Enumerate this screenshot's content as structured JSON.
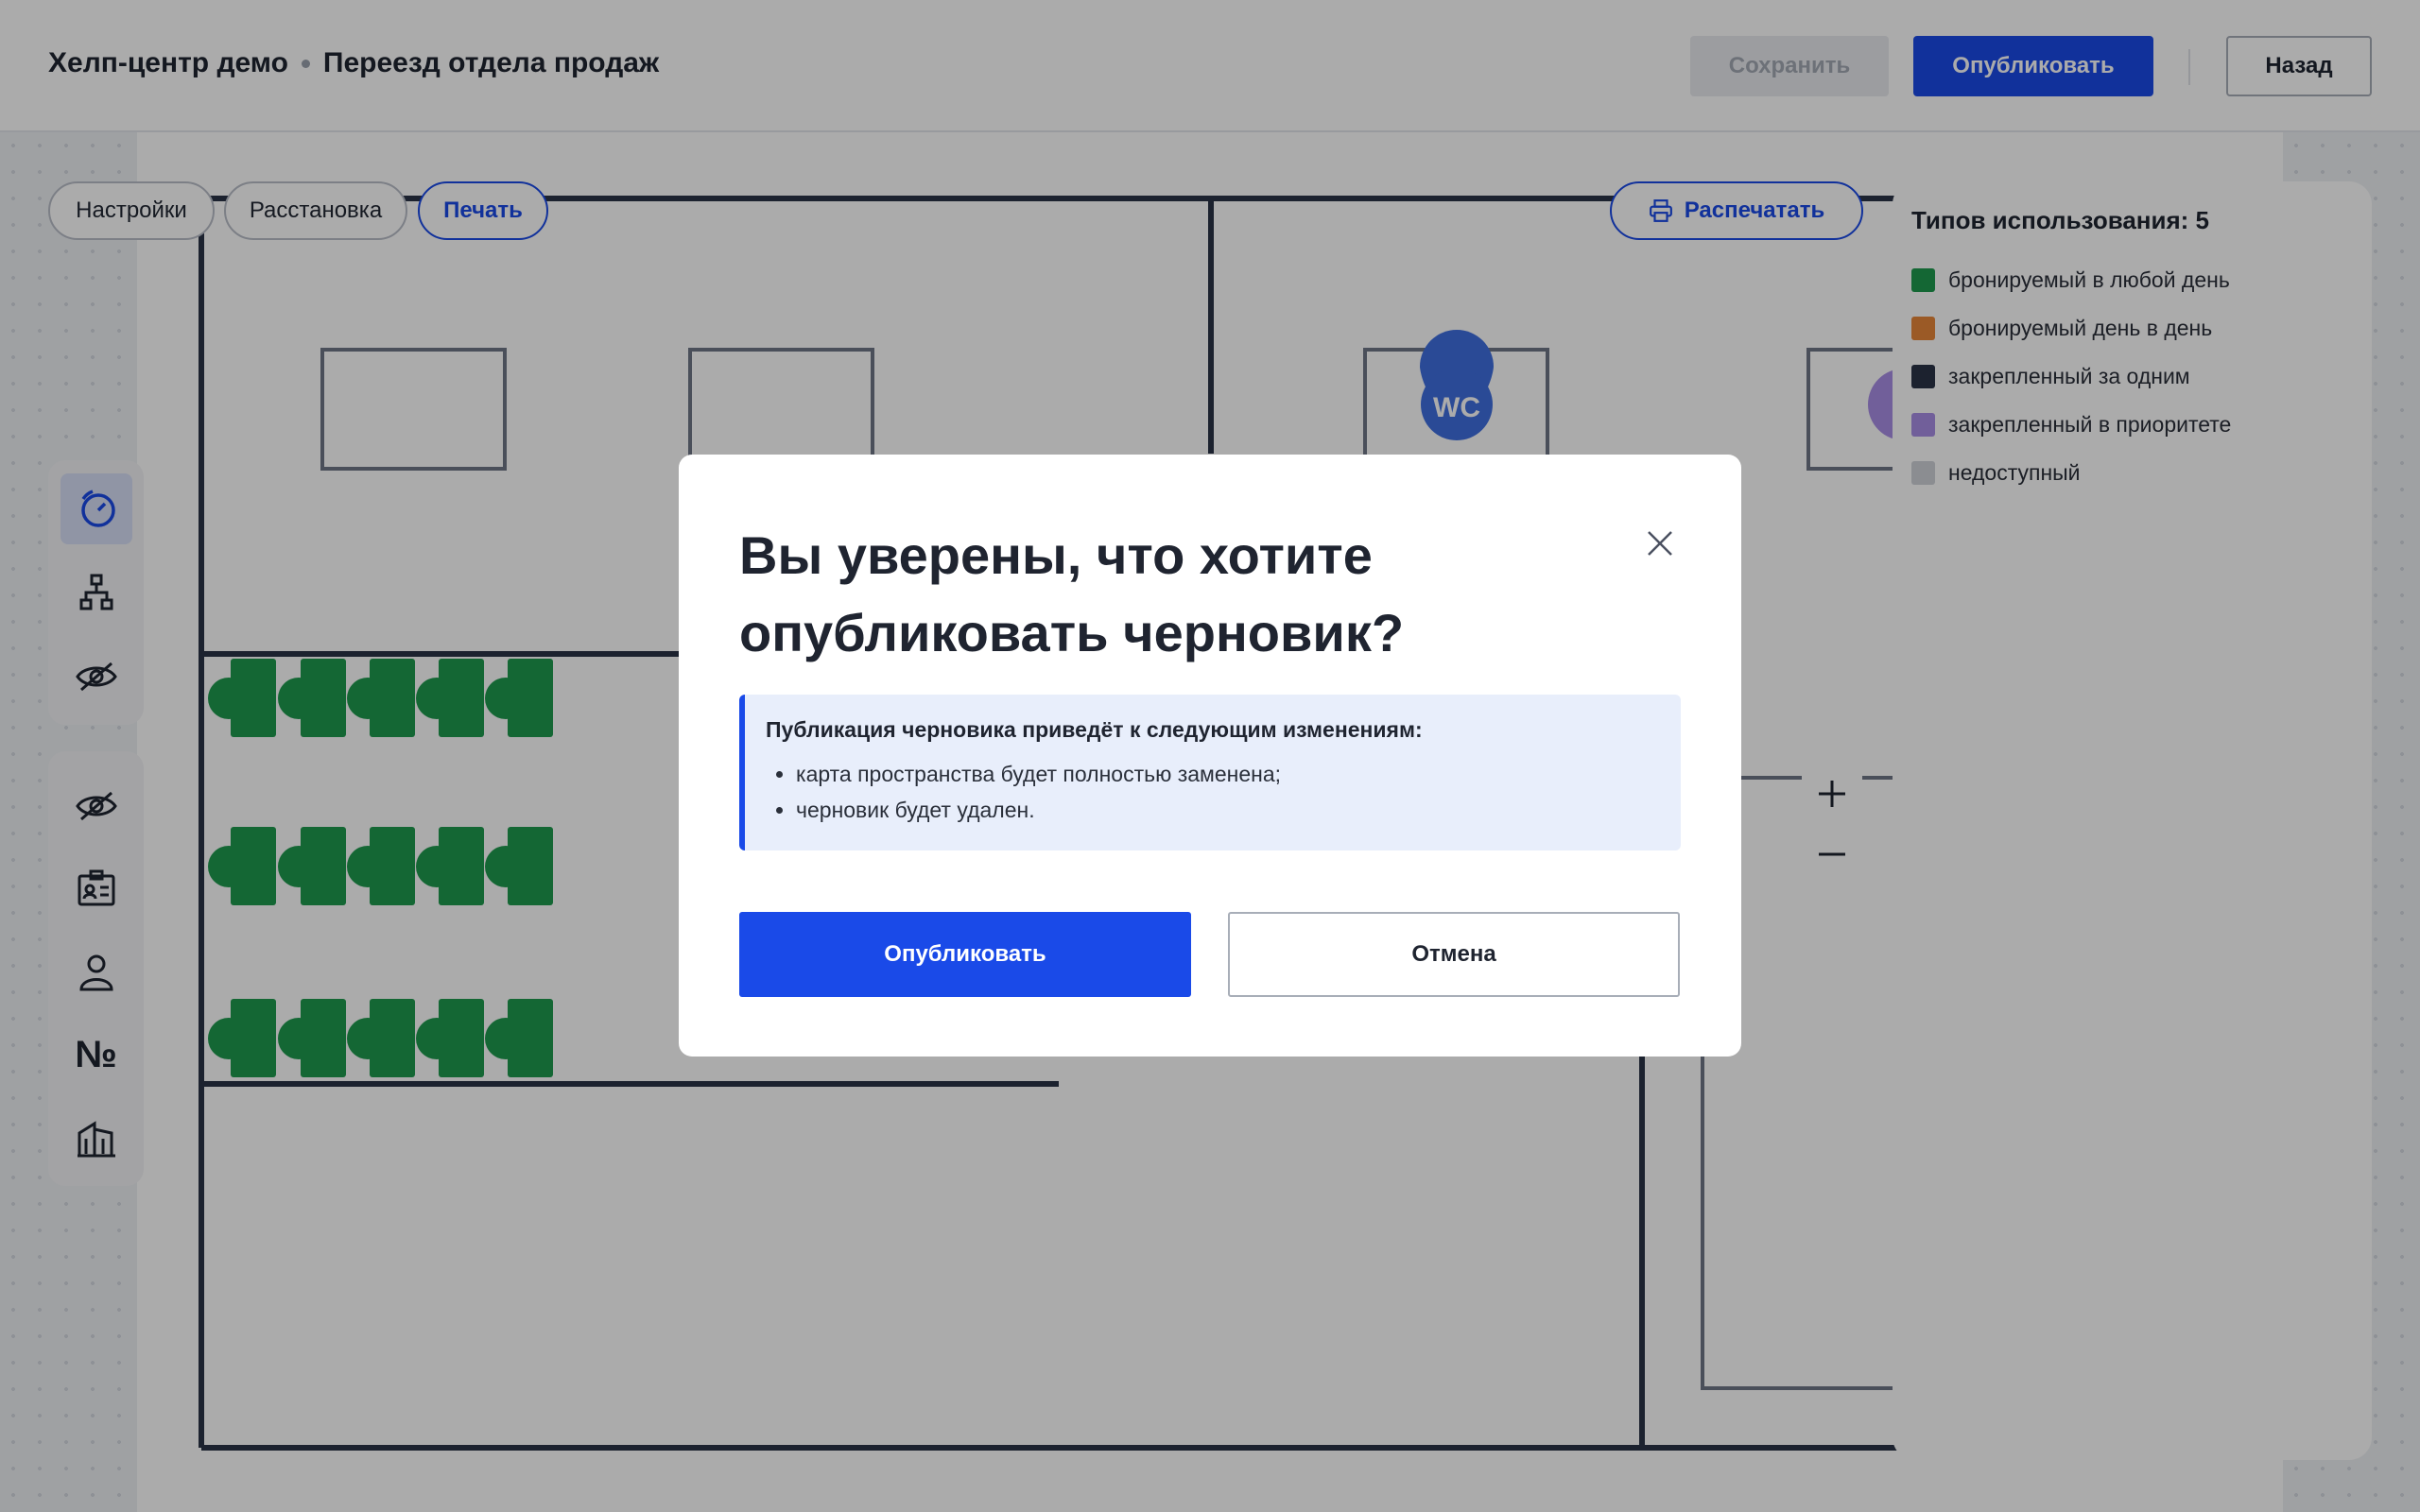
{
  "header": {
    "crumbs": [
      "Хелп-центр демо",
      "Переезд отдела продаж"
    ],
    "save_label": "Сохранить",
    "publish_label": "Опубликовать",
    "back_label": "Назад"
  },
  "mode_pills": {
    "settings": "Настройки",
    "arrange": "Расстановка",
    "print": "Печать"
  },
  "print_button": {
    "label": "Распечатать",
    "icon": "printer-icon"
  },
  "floorplan": {
    "wc_label": "WC"
  },
  "toolbar_top": [
    {
      "icon": "timer-icon",
      "active": true
    },
    {
      "icon": "org-chart-icon",
      "active": false
    },
    {
      "icon": "eye-off-icon",
      "active": false
    }
  ],
  "toolbar_bottom": [
    {
      "icon": "eye-off-icon"
    },
    {
      "icon": "badge-icon"
    },
    {
      "icon": "person-icon"
    },
    {
      "icon": "number-sign",
      "glyph": "№"
    },
    {
      "icon": "building-icon"
    }
  ],
  "zoom": {
    "in_icon": "plus-icon",
    "out_icon": "minus-icon"
  },
  "legend": {
    "title": "Типов использования: 5",
    "items": [
      {
        "label": "бронируемый в любой день",
        "color": "#1f9a4e"
      },
      {
        "label": "бронируемый день в день",
        "color": "#e8873a"
      },
      {
        "label": "закрепленный за одним",
        "color": "#2a3347"
      },
      {
        "label": "закрепленный в приоритете",
        "color": "#a98ee6"
      },
      {
        "label": "недоступный",
        "color": "#cfd2d8"
      }
    ]
  },
  "modal": {
    "title": "Вы уверены, что хотите опубликовать черновик?",
    "notice_title": "Публикация черновика приведёт к следующим изменениям:",
    "notice_items": [
      "карта пространства будет полностью заменена;",
      "черновик будет удален."
    ],
    "publish_label": "Опубликовать",
    "cancel_label": "Отмена"
  },
  "colors": {
    "accent": "#1a4ae8",
    "desk_green": "#1f9a4e",
    "wall": "#2a3347",
    "wc_badge": "#3f6fe0",
    "purple_badge": "#a98ee6"
  }
}
